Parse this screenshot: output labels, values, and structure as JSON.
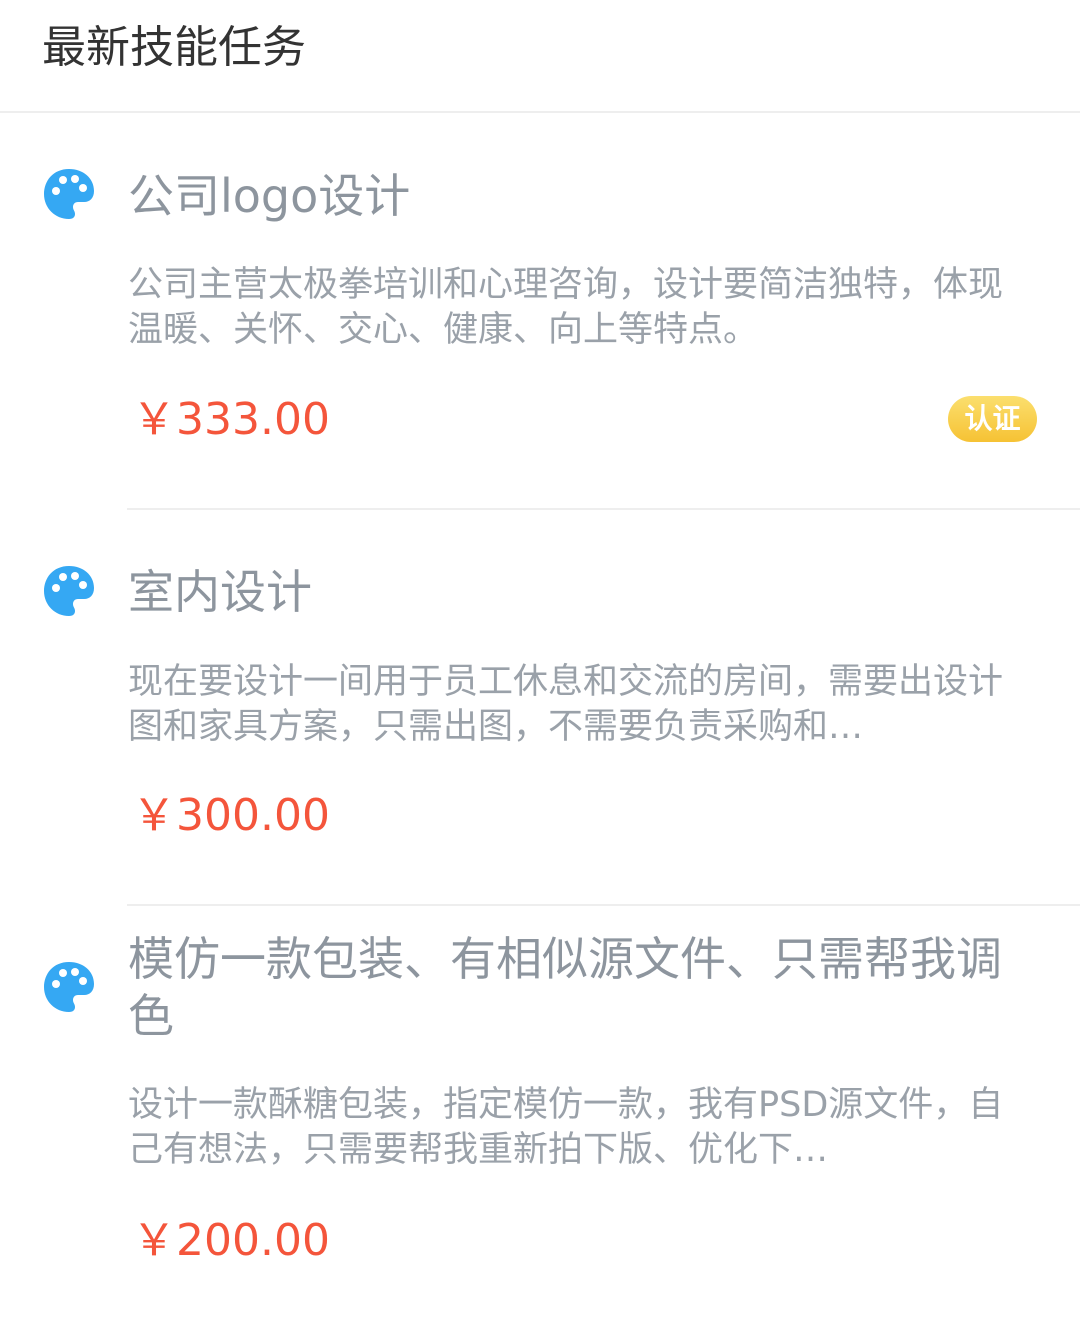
{
  "header": {
    "title": "最新技能任务"
  },
  "tasks": [
    {
      "title": "公司logo设计",
      "description": "公司主营太极拳培训和心理咨询，设计要简洁独特，体现温暖、关怀、交心、健康、向上等特点。",
      "price": "￥333.00",
      "badge": "认证",
      "icon": "palette-icon"
    },
    {
      "title": "室内设计",
      "description": "现在要设计一间用于员工休息和交流的房间，需要出设计图和家具方案，只需出图，不需要负责采购和…",
      "price": "￥300.00",
      "icon": "palette-icon"
    },
    {
      "title": "模仿一款包装、有相似源文件、只需帮我调色",
      "description": "设计一款酥糖包装，指定模仿一款，我有PSD源文件，自己有想法，只需要帮我重新拍下版、优化下…",
      "price": "￥200.00",
      "icon": "palette-icon"
    }
  ],
  "colors": {
    "accent_icon": "#35a8f3",
    "price": "#f4553b",
    "badge": "#f6c234",
    "title_text": "#8d959e",
    "desc_text": "#9aa1a9"
  }
}
